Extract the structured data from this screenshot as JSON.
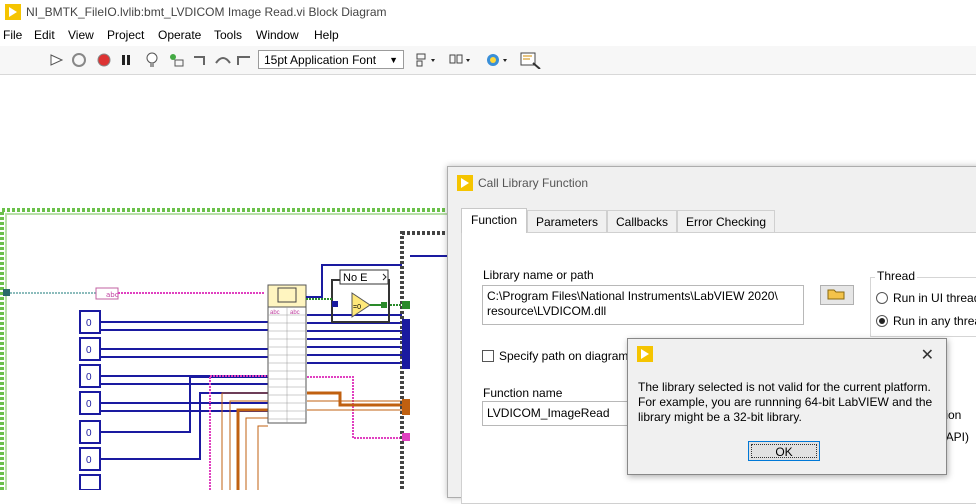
{
  "window": {
    "title": "NI_BMTK_FileIO.lvlib:bmt_LVDICOM Image Read.vi Block Diagram"
  },
  "menu": [
    "File",
    "Edit",
    "View",
    "Project",
    "Operate",
    "Tools",
    "Window",
    "Help"
  ],
  "toolbar": {
    "font_selector": "15pt Application Font"
  },
  "diagram": {
    "case_selector": "No E"
  },
  "dialog": {
    "title": "Call Library Function",
    "tabs": [
      "Function",
      "Parameters",
      "Callbacks",
      "Error Checking"
    ],
    "library_label": "Library name or path",
    "library_path_line1": "C:\\Program Files\\National Instruments\\LabVIEW 2020\\",
    "library_path_line2": "resource\\LVDICOM.dll",
    "specify_path_label": "Specify path on diagram",
    "function_name_label": "Function name",
    "function_name_value": "LVDICOM_ImageRead",
    "thread_label": "Thread",
    "thread_opt1": "Run in UI thread",
    "thread_opt2": "Run in any thread",
    "partial_1": "tion",
    "partial_2": "NAPI)"
  },
  "error_dialog": {
    "message_line1": "The library selected is not valid for the current platform.",
    "message_line2": "For example, you are runnning 64-bit LabVIEW and the",
    "message_line3": "library might be a 32-bit library.",
    "ok_label": "OK"
  },
  "colors": {
    "lv_yellow": "#f5c400",
    "wire_pink": "#e040c0",
    "wire_blue": "#1a1aa0",
    "wire_orange": "#c06010",
    "frame_green": "#6ac04a"
  }
}
